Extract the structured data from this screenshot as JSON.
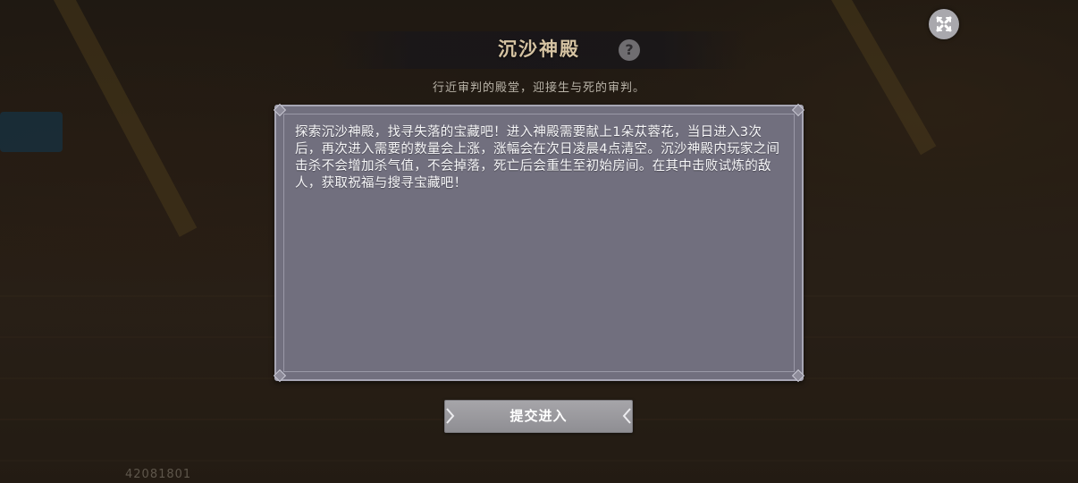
{
  "dialog": {
    "title": "沉沙神殿",
    "help_icon": "?",
    "subtitle": "行近审判的殿堂，迎接生与死的审判。",
    "description": "探索沉沙神殿，找寻失落的宝藏吧！进入神殿需要献上1朵苁蓉花，当日进入3次后，再次进入需要的数量会上涨，涨幅会在次日凌晨4点清空。沉沙神殿内玩家之间击杀不会增加杀气值，不会掉落，死亡后会重生至初始房间。在其中击败试炼的敌人，获取祝福与搜寻宝藏吧！",
    "submit_label": "提交进入"
  },
  "build_id": "42081801",
  "icons": {
    "close": "close-icon",
    "help": "help-icon",
    "chevron_left": "chevron-left-icon",
    "chevron_right": "chevron-right-icon"
  },
  "colors": {
    "title": "#d5c3a2",
    "panel": "#716f7e",
    "button": "#a6a5a9"
  }
}
